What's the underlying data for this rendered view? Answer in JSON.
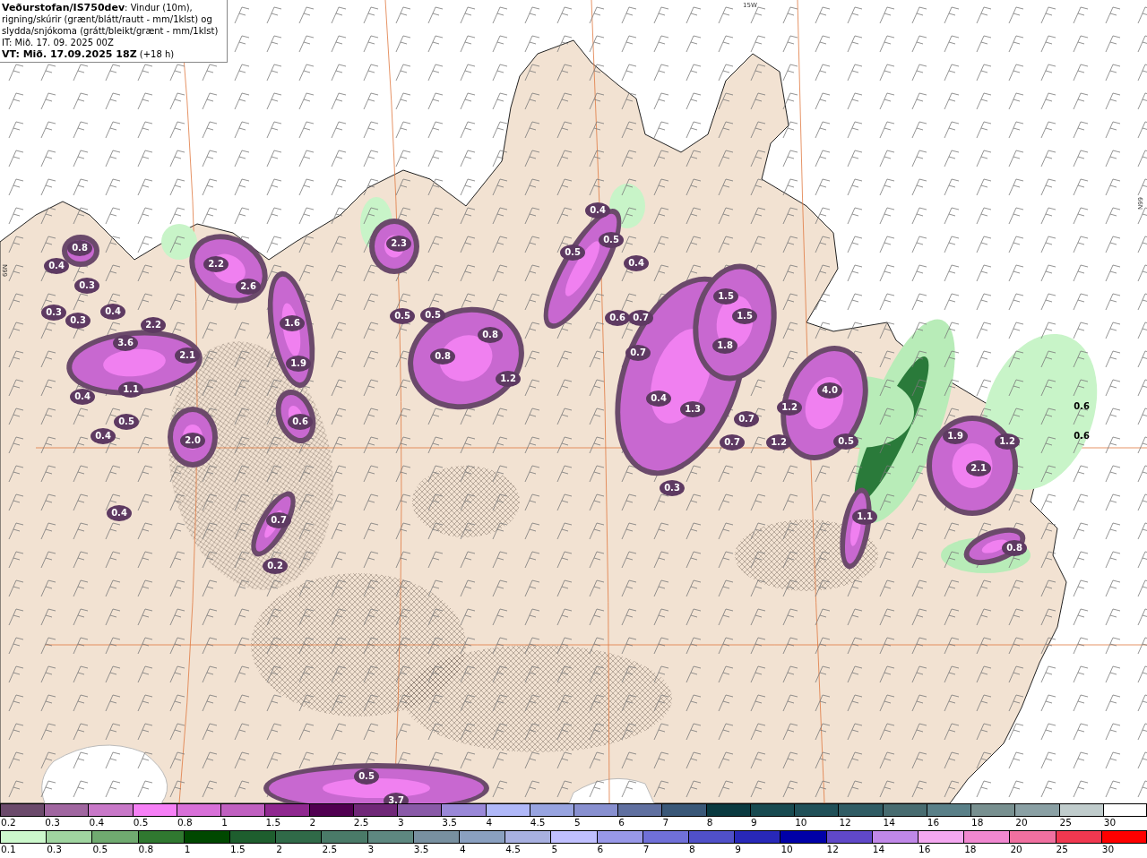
{
  "title_box": {
    "description": "**Veðurstofan/IS750dev**: Vindur (10m), rigning/skúrir (grænt/blátt/rautt - mm/1klst) og slydda/snjókoma (grátt/bleikt/grænt - mm/1klst)",
    "initial_time": "IT: Mið. 17. 09. 2025 00Z",
    "valid_time": "**VT: Mið. 17.09.2025 18Z** (+18 h)"
  },
  "map": {
    "grid_labels": [
      "15W",
      "66N",
      "66N"
    ],
    "precip_labels": [
      "0.8",
      "0.4",
      "0.3",
      "0.3",
      "0.3",
      "0.4",
      "2.2",
      "3.6",
      "2.1",
      "1.1",
      "0.4",
      "0.5",
      "0.4",
      "2.0",
      "0.4",
      "2.2",
      "2.6",
      "1.6",
      "1.9",
      "0.6",
      "0.7",
      "0.2",
      "2.3",
      "0.5",
      "0.5",
      "0.8",
      "0.8",
      "1.2",
      "0.4",
      "0.5",
      "0.5",
      "0.4",
      "0.6",
      "0.7",
      "0.7",
      "0.4",
      "1.5",
      "1.5",
      "1.8",
      "1.3",
      "0.7",
      "0.3",
      "0.7",
      "1.2",
      "1.2",
      "4.0",
      "0.5",
      "1.9",
      "2.1",
      "1.2",
      "0.6",
      "0.6",
      "0.8",
      "1.1",
      "0.5",
      "3.7"
    ]
  },
  "legend_top": {
    "items": [
      {
        "label": "0.2",
        "color": "#6b4a6b"
      },
      {
        "label": "0.3",
        "color": "#a066a0"
      },
      {
        "label": "0.4",
        "color": "#c878c8"
      },
      {
        "label": "0.5",
        "color": "#f680f6"
      },
      {
        "label": "0.8",
        "color": "#d870d8"
      },
      {
        "label": "1",
        "color": "#c060c0"
      },
      {
        "label": "1.5",
        "color": "#902890"
      },
      {
        "label": "2",
        "color": "#500050"
      },
      {
        "label": "2.5",
        "color": "#702878"
      },
      {
        "label": "3",
        "color": "#8a5aa8"
      },
      {
        "label": "3.5",
        "color": "#9a88d8"
      },
      {
        "label": "4",
        "color": "#b0b8f8"
      },
      {
        "label": "4.5",
        "color": "#98a4e0"
      },
      {
        "label": "5",
        "color": "#8890d0"
      },
      {
        "label": "6",
        "color": "#6070a0"
      },
      {
        "label": "7",
        "color": "#3a5878"
      },
      {
        "label": "8",
        "color": "#0a3a40"
      },
      {
        "label": "9",
        "color": "#184a50"
      },
      {
        "label": "10",
        "color": "#205058"
      },
      {
        "label": "12",
        "color": "#305c64"
      },
      {
        "label": "14",
        "color": "#486c70"
      },
      {
        "label": "16",
        "color": "#5a8088"
      },
      {
        "label": "18",
        "color": "#789090"
      },
      {
        "label": "20",
        "color": "#8aa0a4"
      },
      {
        "label": "25",
        "color": "#c0cccc"
      },
      {
        "label": "30",
        "color": "#ffffff"
      }
    ]
  },
  "legend_bottom": {
    "items": [
      {
        "label": "0.1",
        "color": "#ccf8cc"
      },
      {
        "label": "0.3",
        "color": "#a0d4a0"
      },
      {
        "label": "0.5",
        "color": "#70aa70"
      },
      {
        "label": "0.8",
        "color": "#307830"
      },
      {
        "label": "1",
        "color": "#004800"
      },
      {
        "label": "1.5",
        "color": "#1e5e2e"
      },
      {
        "label": "2",
        "color": "#306a48"
      },
      {
        "label": "2.5",
        "color": "#4a7a68"
      },
      {
        "label": "3",
        "color": "#5e8880"
      },
      {
        "label": "3.5",
        "color": "#7890a0"
      },
      {
        "label": "4",
        "color": "#8aa0c0"
      },
      {
        "label": "4.5",
        "color": "#a8b0e0"
      },
      {
        "label": "5",
        "color": "#c0c0ff"
      },
      {
        "label": "6",
        "color": "#9898e8"
      },
      {
        "label": "7",
        "color": "#7070d8"
      },
      {
        "label": "8",
        "color": "#5050c8"
      },
      {
        "label": "9",
        "color": "#2828b8"
      },
      {
        "label": "10",
        "color": "#0000a8"
      },
      {
        "label": "12",
        "color": "#6048c8"
      },
      {
        "label": "14",
        "color": "#c088e8"
      },
      {
        "label": "16",
        "color": "#f4a8f0"
      },
      {
        "label": "18",
        "color": "#f088d0"
      },
      {
        "label": "20",
        "color": "#f070a0"
      },
      {
        "label": "25",
        "color": "#f03850"
      },
      {
        "label": "30",
        "color": "#ff0000"
      }
    ]
  }
}
